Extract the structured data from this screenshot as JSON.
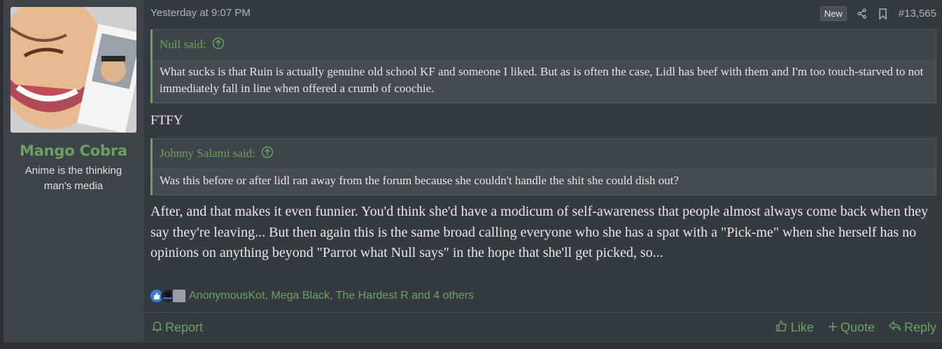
{
  "user": {
    "name": "Mango Cobra",
    "title": "Anime is the thinking man's media"
  },
  "post": {
    "timestamp": "Yesterday at 9:07 PM",
    "new_label": "New",
    "post_number": "#13,565"
  },
  "quote1": {
    "author": "Null said:",
    "text": "What sucks is that Ruin is actually genuine old school KF and someone I liked. But as is often the case, Lidl has beef with them and I'm too touch-starved to not immediately fall in line when offered a crumb of coochie."
  },
  "ftfy": "FTFY",
  "quote2": {
    "author": "Johnny Salami said:",
    "text": "Was this before or after lidl ran away from the forum because she couldn't handle the shit she could dish out?"
  },
  "reply": "After, and that makes it even funnier. You'd think she'd have a modicum of self-awareness that people almost always come back when they say they're leaving... But then again this is the same broad calling everyone who she has a spat with a \"Pick-me\" when she herself has no opinions on anything beyond \"Parrot what Null says\" in the hope that she'll get picked, so...",
  "reactions": {
    "text": "AnonymousKot, Mega Black, The Hardest R and 4 others",
    "icons": [
      "like-icon",
      "hat-icon",
      "ruler-icon"
    ]
  },
  "footer": {
    "report": "Report",
    "like": "Like",
    "quote": "Quote",
    "reply": "Reply"
  },
  "colors": {
    "accent": "#6ba35e",
    "background": "#353940",
    "sidebar": "#3e4249"
  }
}
